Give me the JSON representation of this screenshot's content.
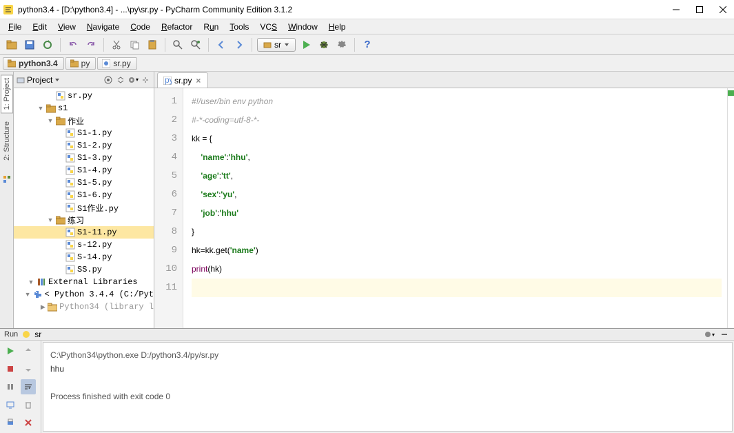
{
  "title": "python3.4 - [D:\\python3.4] - ...\\py\\sr.py - PyCharm Community Edition 3.1.2",
  "menu": [
    "File",
    "Edit",
    "View",
    "Navigate",
    "Code",
    "Refactor",
    "Run",
    "Tools",
    "VCS",
    "Window",
    "Help"
  ],
  "menu_accel": [
    "F",
    "E",
    "V",
    "N",
    "C",
    "R",
    "u",
    "T",
    "S",
    "W",
    "H"
  ],
  "run_config": "sr",
  "breadcrumb": [
    {
      "label": "python3.4",
      "type": "folder",
      "bold": true
    },
    {
      "label": "py",
      "type": "folder",
      "bold": false
    },
    {
      "label": "sr.py",
      "type": "py",
      "bold": false
    }
  ],
  "sidebar": {
    "tabs": [
      "1: Project",
      "2: Structure"
    ]
  },
  "panel": {
    "title": "Project"
  },
  "tree": [
    {
      "indent": 3,
      "arrow": "",
      "icon": "py",
      "label": "sr.py",
      "sel": false
    },
    {
      "indent": 2,
      "arrow": "▼",
      "icon": "folder",
      "label": "s1",
      "sel": false
    },
    {
      "indent": 3,
      "arrow": "▼",
      "icon": "folder",
      "label": "作业",
      "sel": false
    },
    {
      "indent": 4,
      "arrow": "",
      "icon": "py",
      "label": "S1-1.py",
      "sel": false
    },
    {
      "indent": 4,
      "arrow": "",
      "icon": "py",
      "label": "S1-2.py",
      "sel": false
    },
    {
      "indent": 4,
      "arrow": "",
      "icon": "py",
      "label": "S1-3.py",
      "sel": false
    },
    {
      "indent": 4,
      "arrow": "",
      "icon": "py",
      "label": "S1-4.py",
      "sel": false
    },
    {
      "indent": 4,
      "arrow": "",
      "icon": "py",
      "label": "S1-5.py",
      "sel": false
    },
    {
      "indent": 4,
      "arrow": "",
      "icon": "py",
      "label": "S1-6.py",
      "sel": false
    },
    {
      "indent": 4,
      "arrow": "",
      "icon": "py",
      "label": "S1作业.py",
      "sel": false
    },
    {
      "indent": 3,
      "arrow": "▼",
      "icon": "folder",
      "label": "练习",
      "sel": false
    },
    {
      "indent": 4,
      "arrow": "",
      "icon": "py",
      "label": "S1-11.py",
      "sel": true
    },
    {
      "indent": 4,
      "arrow": "",
      "icon": "py",
      "label": "s-12.py",
      "sel": false
    },
    {
      "indent": 4,
      "arrow": "",
      "icon": "py",
      "label": "S-14.py",
      "sel": false
    },
    {
      "indent": 4,
      "arrow": "",
      "icon": "py",
      "label": "SS.py",
      "sel": false
    },
    {
      "indent": 1,
      "arrow": "▼",
      "icon": "lib",
      "label": "External Libraries",
      "sel": false
    },
    {
      "indent": 2,
      "arrow": "▼",
      "icon": "python",
      "label": "< Python 3.4.4 (C:/Pyt",
      "sel": false
    },
    {
      "indent": 3,
      "arrow": "▶",
      "icon": "folder-lib",
      "label": "Python34 (library l",
      "sel": false,
      "muted": true
    }
  ],
  "editor_tab": {
    "label": "sr.py"
  },
  "code": {
    "lines": [
      {
        "n": 1,
        "html": "<span class='c-comment'>#!/user/bin env python</span>"
      },
      {
        "n": 2,
        "html": "<span class='c-comment'>#-*-coding=utf-8-*-</span>"
      },
      {
        "n": 3,
        "html": "kk = {"
      },
      {
        "n": 4,
        "html": "    <span class='c-string'>'name'</span>:<span class='c-string'>'hhu'</span>,"
      },
      {
        "n": 5,
        "html": "    <span class='c-string'>'age'</span>:<span class='c-string'>'tt'</span>,"
      },
      {
        "n": 6,
        "html": "    <span class='c-string'>'sex'</span>:<span class='c-string'>'yu'</span>,"
      },
      {
        "n": 7,
        "html": "    <span class='c-string'>'job'</span>:<span class='c-string'>'hhu'</span>"
      },
      {
        "n": 8,
        "html": "}"
      },
      {
        "n": 9,
        "html": "hk=kk.get(<span class='c-string'>'name'</span>)"
      },
      {
        "n": 10,
        "html": "<span class='c-func'>print</span>(hk)"
      },
      {
        "n": 11,
        "html": "",
        "current": true
      }
    ]
  },
  "run": {
    "title": "Run",
    "config": "sr",
    "command": "C:\\Python34\\python.exe D:/python3.4/py/sr.py",
    "output": "hhu",
    "exit": "Process finished with exit code 0"
  },
  "icons": {
    "folder": "#d9a94a",
    "py": "#5a8ad6",
    "run": "#4caf50",
    "bug": "#6a8a3a"
  }
}
